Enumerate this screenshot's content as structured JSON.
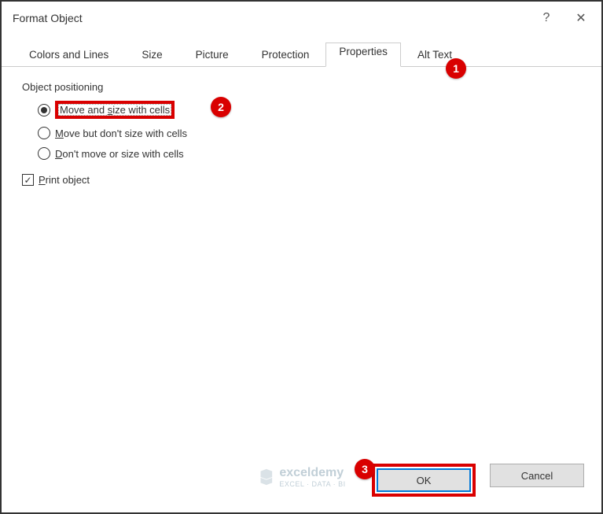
{
  "dialog": {
    "title": "Format Object",
    "help": "?",
    "close": "✕"
  },
  "tabs": {
    "colors": "Colors and Lines",
    "size": "Size",
    "picture": "Picture",
    "protection": "Protection",
    "properties": "Properties",
    "alttext": "Alt Text"
  },
  "content": {
    "groupLabel": "Object positioning",
    "opt1_pre": "Move and ",
    "opt1_u": "s",
    "opt1_post": "ize with cells",
    "opt2_pre": "",
    "opt2_u": "M",
    "opt2_post": "ove but don't size with cells",
    "opt3_pre": "",
    "opt3_u": "D",
    "opt3_post": "on't move or size with cells",
    "print_pre": "",
    "print_u": "P",
    "print_post": "rint object",
    "check_mark": "✓"
  },
  "buttons": {
    "ok": "OK",
    "cancel": "Cancel"
  },
  "badges": {
    "b1": "1",
    "b2": "2",
    "b3": "3"
  },
  "watermark": {
    "brand": "exceldemy",
    "sub": "EXCEL · DATA · BI"
  }
}
